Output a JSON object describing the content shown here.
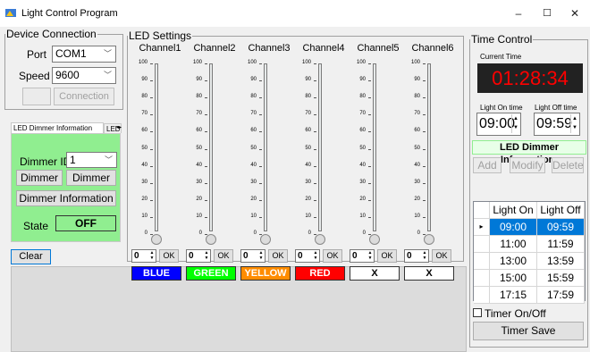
{
  "window": {
    "title": "Light Control Program",
    "minimize": "–",
    "maximize": "☐",
    "close": "✕"
  },
  "device_connection": {
    "legend": "Device Connection",
    "port_label": "Port",
    "port_value": "COM1",
    "speed_label": "Speed",
    "speed_value": "9600",
    "connection_button": "Connection"
  },
  "tabs": {
    "active": "LED Dimmer Information",
    "second": "LED"
  },
  "dimmer": {
    "id_label": "Dimmer ID",
    "id_value": "1",
    "btn1": "Dimmer",
    "btn2": "Dimmer",
    "info_button": "Dimmer Information",
    "state_label": "State",
    "state_value": "OFF"
  },
  "clear_button": "Clear",
  "led_settings": {
    "legend": "LED Settings",
    "ticks": [
      "100",
      "90",
      "80",
      "70",
      "60",
      "50",
      "40",
      "30",
      "20",
      "10",
      "0"
    ],
    "ok_label": "OK",
    "channels": [
      {
        "name": "Channel1",
        "value": "0",
        "color_label": "BLUE",
        "color": "#0000ff",
        "text_color": "#ffffff"
      },
      {
        "name": "Channel2",
        "value": "0",
        "color_label": "GREEN",
        "color": "#00ff00",
        "text_color": "#ffffff"
      },
      {
        "name": "Channel3",
        "value": "0",
        "color_label": "YELLOW",
        "color": "#ff8c00",
        "text_color": "#ffffff"
      },
      {
        "name": "Channel4",
        "value": "0",
        "color_label": "RED",
        "color": "#ff0000",
        "text_color": "#ffffff"
      },
      {
        "name": "Channel5",
        "value": "0",
        "color_label": "X",
        "color": "#ffffff",
        "text_color": "#000000"
      },
      {
        "name": "Channel6",
        "value": "0",
        "color_label": "X",
        "color": "#ffffff",
        "text_color": "#000000"
      }
    ]
  },
  "time_control": {
    "legend": "Time Control",
    "current_time_label": "Current Time",
    "current_time": "01:28:34",
    "light_on_label": "Light On time",
    "light_off_label": "Light Off time",
    "light_on_value": "09:00",
    "light_off_value": "09:59",
    "info_header": "LED Dimmer Information:",
    "add_button": "Add",
    "modify_button": "Modify",
    "delete_button": "Delete",
    "grid_headers": [
      "Light On",
      "Light Off"
    ],
    "grid_rows": [
      {
        "on": "09:00",
        "off": "09:59"
      },
      {
        "on": "11:00",
        "off": "11:59"
      },
      {
        "on": "13:00",
        "off": "13:59"
      },
      {
        "on": "15:00",
        "off": "15:59"
      },
      {
        "on": "17:15",
        "off": "17:59"
      }
    ],
    "timer_checkbox_label": "Timer On/Off",
    "timer_save_button": "Timer Save"
  },
  "colors": {
    "clock_bg": "#222222",
    "clock_fg": "#ff0000",
    "state_bg": "#90ee90",
    "panel_green": "#90ee90",
    "header_bg": "#e8ffe8",
    "selected_row": "#0078d7"
  }
}
